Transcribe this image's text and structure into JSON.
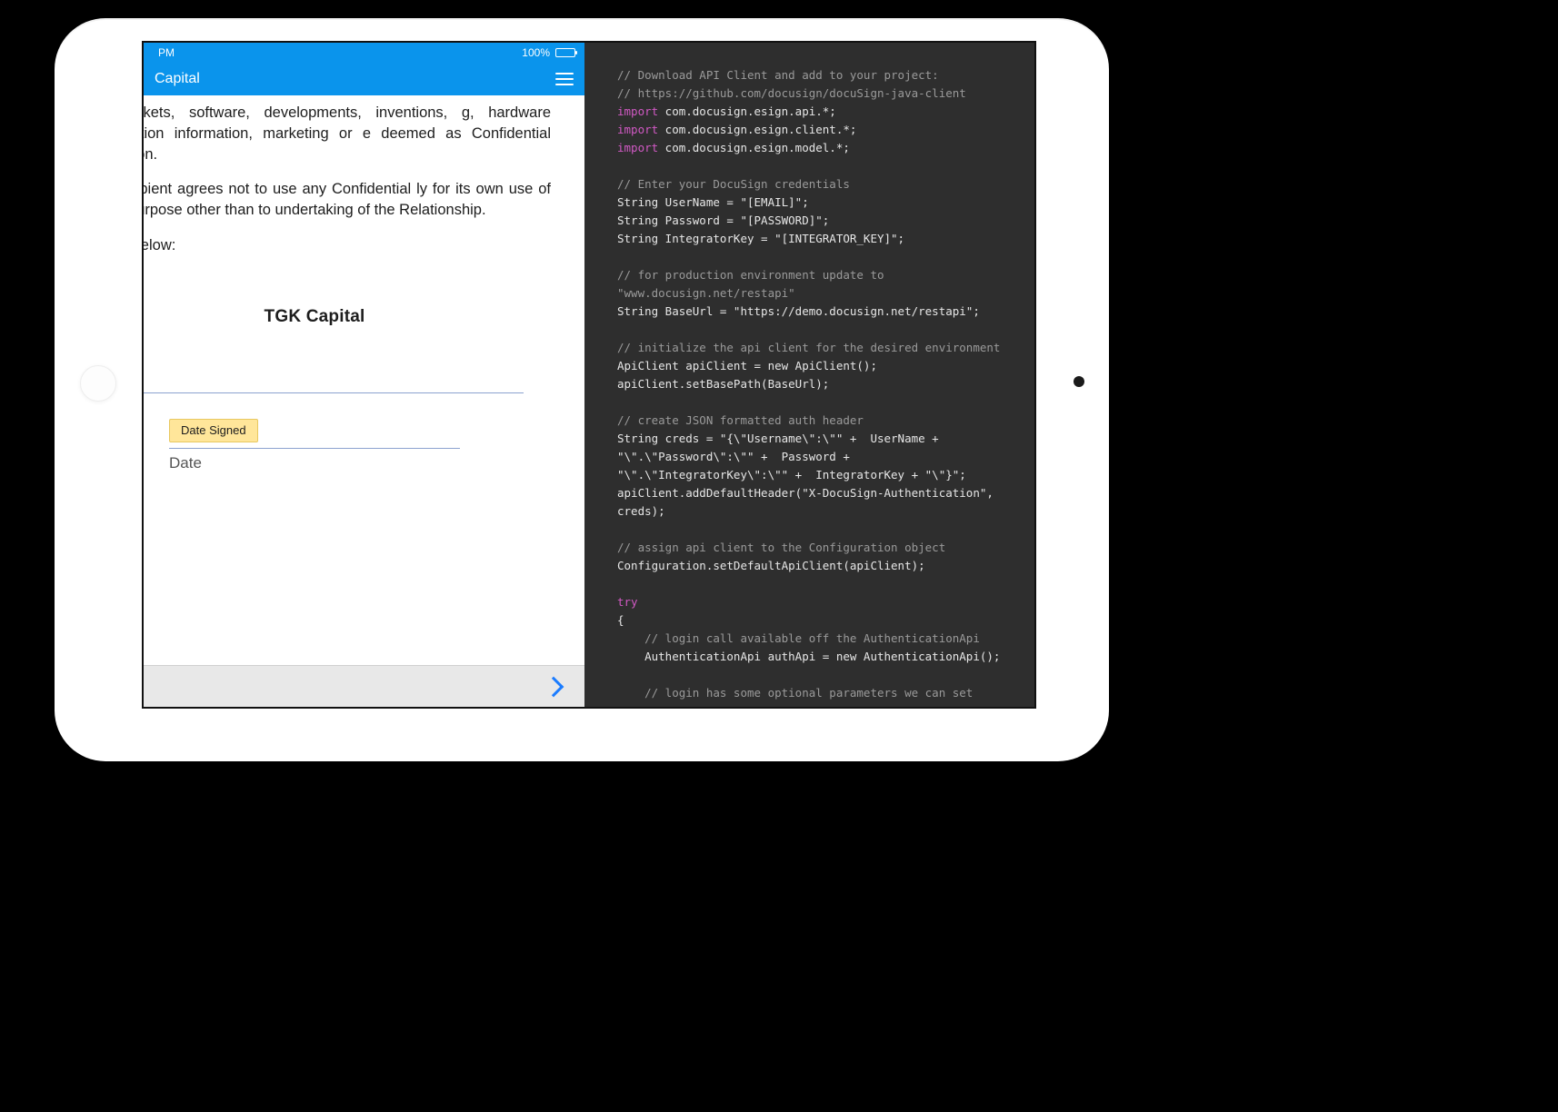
{
  "statusbar": {
    "time": "PM",
    "battery": "100%"
  },
  "navbar": {
    "title": "Capital"
  },
  "document": {
    "para1": "ers, markets, software, developments, inventions, g, hardware configuration information, marketing or e deemed as Confidential Information.",
    "para2": "The Recipient agrees not to use any Confidential ly for its own use of for any purpose other than to undertaking of the Relationship.",
    "para3": "he date below:",
    "company": "TGK Capital",
    "date_pill": "Date Signed",
    "date_label": "Date"
  },
  "colors": {
    "accent": "#0a94ec",
    "pill": "#ffe69a",
    "link": "#1b7cff"
  },
  "code": {
    "c1": "// Download API Client and add to your project:",
    "c2": "// https://github.com/docusign/docuSign-java-client",
    "kw": "import",
    "i1": " com.docusign.esign.api.*;",
    "i2": " com.docusign.esign.client.*;",
    "i3": " com.docusign.esign.model.*;",
    "c3": "// Enter your DocuSign credentials",
    "l1": "String UserName = \"[EMAIL]\";",
    "l2": "String Password = \"[PASSWORD]\";",
    "l3": "String IntegratorKey = \"[INTEGRATOR_KEY]\";",
    "c4a": "// for production environment update to",
    "c4b": "\"www.docusign.net/restapi\"",
    "l4": "String BaseUrl = \"https://demo.docusign.net/restapi\";",
    "c5": "// initialize the api client for the desired environment",
    "l5": "ApiClient apiClient = new ApiClient();",
    "l6": "apiClient.setBasePath(BaseUrl);",
    "c6": "// create JSON formatted auth header",
    "l7a": "String creds = \"{\\\"Username\\\":\\\"\" +  UserName +",
    "l7b": "\"\\\".\\\"Password\\\":\\\"\" +  Password +",
    "l7c": "\"\\\".\\\"IntegratorKey\\\":\\\"\" +  IntegratorKey + \"\\\"}\";",
    "l8a": "apiClient.addDefaultHeader(\"X-DocuSign-Authentication\",",
    "l8b": "creds);",
    "c7": "// assign api client to the Configuration object",
    "l9": "Configuration.setDefaultApiClient(apiClient);",
    "kw2": "try",
    "l10": "{",
    "c8": "    // login call available off the AuthenticationApi",
    "l11": "    AuthenticationApi authApi = new AuthenticationApi();",
    "c9": "    // login has some optional parameters we can set"
  }
}
